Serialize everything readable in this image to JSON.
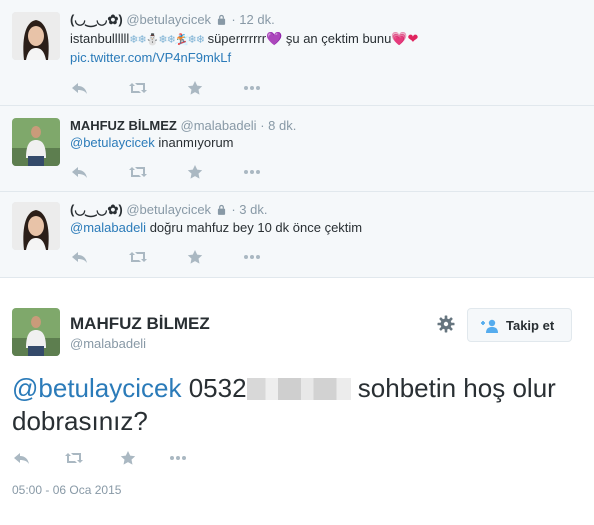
{
  "tweets": [
    {
      "fullname": "(◡‿◡✿)",
      "username": "@betulaycicek",
      "sep": "·",
      "time": "12 dk.",
      "protected": true,
      "text_before": "istanbullllll",
      "text_emoji": "❄❄⛄❄❄🏂❄❄",
      "text_after": " süperrrrrrr",
      "text_tail": " şu an çektim bunu",
      "heart1": "💜",
      "heart2": "💗❤",
      "link": "pic.twitter.com/VP4nF9mkLf"
    },
    {
      "fullname": "MAHFUZ BİLMEZ",
      "username": "@malabadeli",
      "sep": "·",
      "time": "8 dk.",
      "mention": "@betulaycicek",
      "text": " inanmıyorum"
    },
    {
      "fullname": "(◡‿◡✿)",
      "username": "@betulaycicek",
      "sep": "·",
      "time": "3 dk.",
      "protected": true,
      "mention": "@malabadeli",
      "text": " doğru mahfuz bey 10 dk önce çektim"
    }
  ],
  "main": {
    "fullname": "MAHFUZ BİLMEZ",
    "username": "@malabadeli",
    "follow_label": "Takip et",
    "mention": "@betulaycicek",
    "number": "0532",
    "text_after": " sohbetin hoş olur dobrasınız?",
    "timestamp": "05:00 - 06 Oca 2015"
  },
  "icons": [
    "reply-icon",
    "retweet-icon",
    "favorite-icon",
    "more-icon",
    "gear-icon",
    "follow-person-icon",
    "lock-icon"
  ],
  "colors": {
    "link": "#2b7bb9",
    "muted": "#8899a6",
    "bg_reply": "#f5f8fa"
  }
}
